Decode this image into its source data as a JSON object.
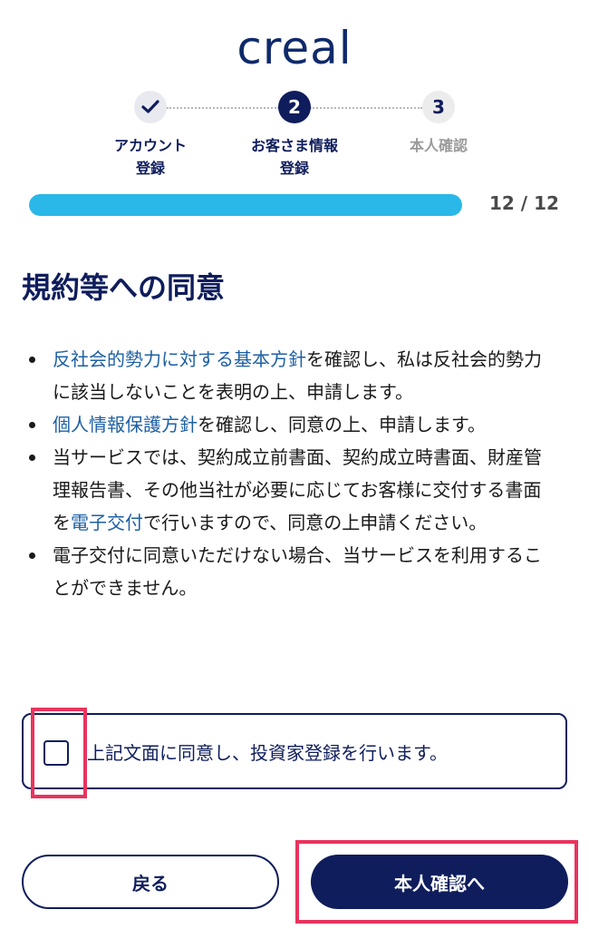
{
  "brand": {
    "logo_text": "creal"
  },
  "stepper": {
    "steps": [
      {
        "number": "",
        "label": "アカウント\n登録",
        "state": "done"
      },
      {
        "number": "2",
        "label": "お客さま情報\n登録",
        "state": "active"
      },
      {
        "number": "3",
        "label": "本人確認",
        "state": "todo"
      }
    ]
  },
  "progress": {
    "text": "12 / 12",
    "fraction": 1.0
  },
  "page_title": "規約等への同意",
  "terms": {
    "item1": {
      "link": "反社会的勢力に対する基本方針",
      "rest": "を確認し、私は反社会的勢力に該当しないことを表明の上、申請します。"
    },
    "item2": {
      "link": "個人情報保護方針",
      "rest": "を確認し、同意の上、申請します。"
    },
    "item3": {
      "pre": "当サービスでは、契約成立前書面、契約成立時書面、財産管理報告書、その他当社が必要に応じてお客様に交付する書面を",
      "link": "電子交付",
      "rest": "で行いますので、同意の上申請ください。"
    },
    "item4": {
      "text": "電子交付に同意いただけない場合、当サービスを利用することができません。"
    }
  },
  "agreement": {
    "label": "上記文面に同意し、投資家登録を行います。",
    "checked": false
  },
  "buttons": {
    "back": "戻る",
    "next": "本人確認へ"
  },
  "colors": {
    "navy": "#0f1d5c",
    "progress": "#29b8e8",
    "link": "#1d5fa5",
    "highlight": "#e8345e"
  }
}
